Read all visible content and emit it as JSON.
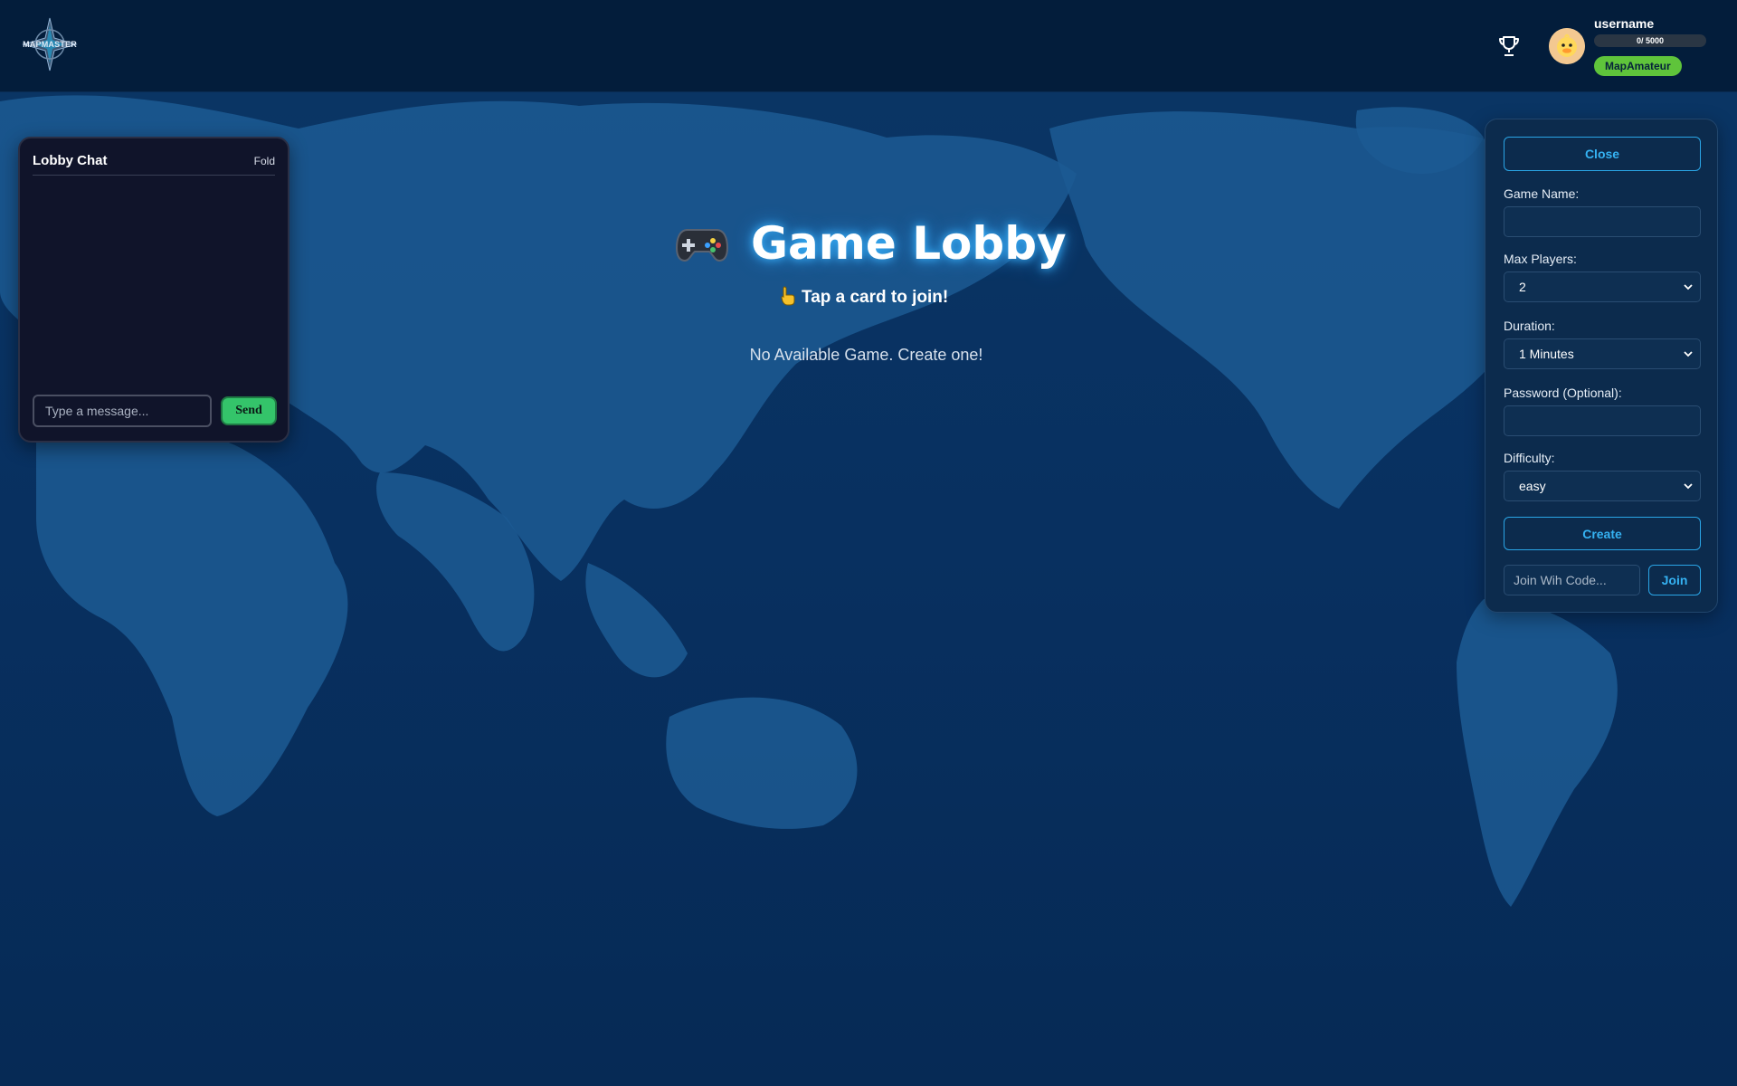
{
  "header": {
    "logo_text": "MAPMASTER",
    "username": "username",
    "xp_text": "0/ 5000",
    "xp_progress": 0,
    "rank": "MapAmateur"
  },
  "chat": {
    "title": "Lobby Chat",
    "fold_label": "Fold",
    "input_placeholder": "Type a message...",
    "send_label": "Send"
  },
  "lobby": {
    "title": "Game Lobby",
    "subtitle": "Tap a card to join!",
    "empty_message": "No Available Game. Create one!"
  },
  "create_panel": {
    "close_label": "Close",
    "game_name_label": "Game Name:",
    "game_name_value": "",
    "max_players_label": "Max Players:",
    "max_players_value": "2",
    "duration_label": "Duration:",
    "duration_value": "1 Minutes",
    "password_label": "Password (Optional):",
    "password_value": "",
    "difficulty_label": "Difficulty:",
    "difficulty_value": "easy",
    "create_label": "Create",
    "join_code_placeholder": "Join Wih Code...",
    "join_label": "Join"
  },
  "colors": {
    "header_bg": "#031d3b",
    "map_bg": "#083060",
    "accent": "#35b2f2",
    "send_green": "#34c46a",
    "rank_green": "#5fc43b"
  },
  "icons": {
    "logo": "compass-logo-icon",
    "trophy": "trophy-icon",
    "avatar": "duck-avatar-icon",
    "title": "game-controller-icon",
    "subtitle": "pointing-hand-icon",
    "select": "chevron-down-icon"
  }
}
